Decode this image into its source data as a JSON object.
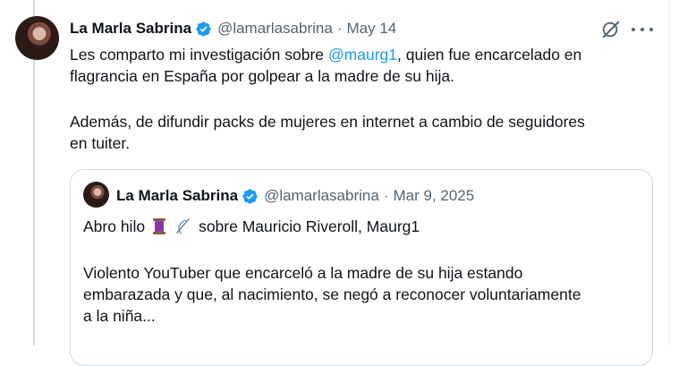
{
  "tweet": {
    "author_name": "La Marla Sabrina",
    "handle": "@lamarlasabrina",
    "separator": "·",
    "date": "May 14",
    "text_part1": "Les comparto mi investigación sobre ",
    "mention": "@maurg1",
    "text_part2": ", quien fue encarcelado en\nflagrancia en España por golpear a la madre de su hija.",
    "paragraph2": "Además, de difundir packs de mujeres en internet a cambio de seguidores\nen tuiter."
  },
  "quoted": {
    "author_name": "La Marla Sabrina",
    "handle": "@lamarlasabrina",
    "separator": "·",
    "date": "Mar 9, 2025",
    "line1_start": "Abro hilo",
    "line1_end": "sobre Mauricio Riveroll, Maurg1",
    "paragraph2": "Violento YouTuber que encarceló a la madre de su hija estando\nembarazada y que, al nacimiento, se negó a reconocer voluntariamente\na la niña..."
  },
  "icons": {
    "verified": "verified-badge-icon",
    "grok": "grok-icon",
    "more": "more-options-icon",
    "spool": "thread-spool-emoji",
    "needle": "sewing-needle-emoji"
  },
  "colors": {
    "accent": "#1d9bf0",
    "secondary_text": "#536471",
    "border": "#cfd9de"
  }
}
